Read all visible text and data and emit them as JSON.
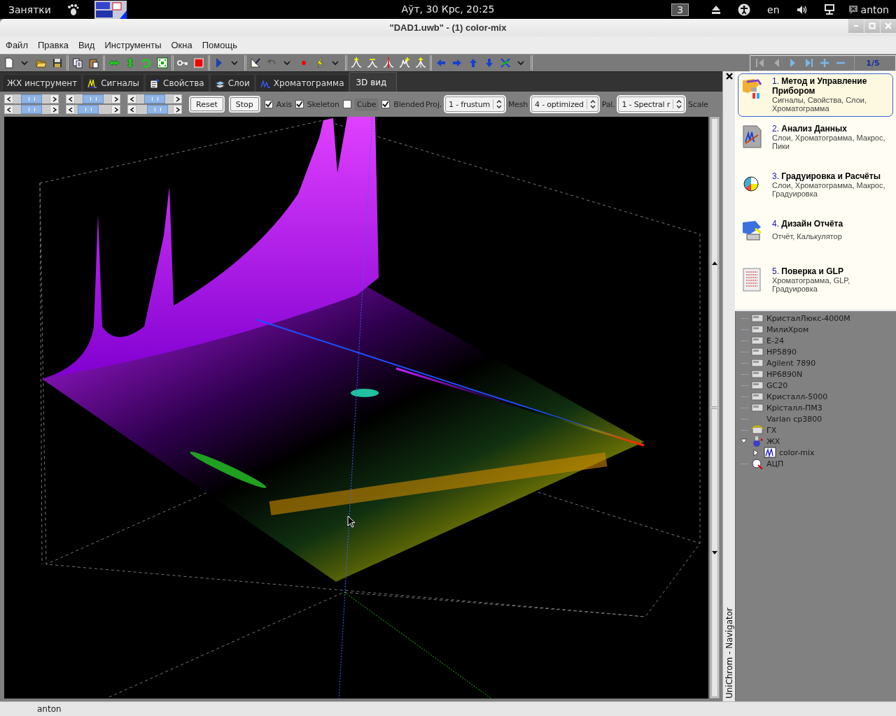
{
  "top_panel": {
    "activities": "Занятки",
    "clock": "Аўт, 30 Крс, 20:25",
    "workspace": "3",
    "keyboard_layout": "en",
    "user": "anton"
  },
  "window": {
    "title": "\"DAD1.uwb\" - (1) color-mix"
  },
  "menu": [
    "Файл",
    "Правка",
    "Вид",
    "Инструменты",
    "Окна",
    "Помощь"
  ],
  "toolbar": {
    "page_indicator": "1/5"
  },
  "tabs": [
    {
      "label": "ЖХ инструмент",
      "kind": "plain",
      "selected": false
    },
    {
      "label": "Сигналы",
      "kind": "signals",
      "selected": false
    },
    {
      "label": "Свойства",
      "kind": "properties",
      "selected": false
    },
    {
      "label": "Слои",
      "kind": "layers",
      "selected": false
    },
    {
      "label": "Хроматограмма",
      "kind": "chromatogram",
      "selected": false
    },
    {
      "label": "3D вид",
      "kind": "plain",
      "selected": true
    }
  ],
  "view_controls": {
    "buttons": [
      "Reset",
      "Stop"
    ],
    "checkboxes": [
      {
        "label": "Axis",
        "checked": true
      },
      {
        "label": "Skeleton",
        "checked": true
      },
      {
        "label": "Cube",
        "checked": false
      },
      {
        "label": "Blended",
        "checked": true
      }
    ],
    "selects": [
      {
        "label": "Proj.",
        "value": "1 - frustum"
      },
      {
        "label": "Mesh",
        "value": "4 - optimized"
      },
      {
        "label": "Pal.",
        "value": "1 - Spectral r"
      }
    ],
    "scale_label": "Scale"
  },
  "navigator": {
    "title": "UniChrom - Navigator",
    "items": [
      {
        "number": "1.",
        "title": "Метод и Управление Прибором",
        "subtitle": "Сигналы, Свойства, Слои, Хроматограмма",
        "kind": "method",
        "selected": true
      },
      {
        "number": "2.",
        "title": "Анализ Данных",
        "subtitle": "Слои, Хроматограмма, Макрос, Пики",
        "kind": "analysis",
        "selected": false
      },
      {
        "number": "3.",
        "title": "Градуировка и Расчёты",
        "subtitle": "Слои, Хроматограмма, Макрос, Градуировка",
        "kind": "calibration",
        "selected": false
      },
      {
        "number": "4.",
        "title": "Дизайн Отчёта",
        "subtitle": "Отчёт, Калькулятор",
        "kind": "report",
        "selected": false
      },
      {
        "number": "5.",
        "title": "Поверка и GLP",
        "subtitle": "Хроматограмма, GLP, Градуировка",
        "kind": "verification",
        "selected": false
      }
    ]
  },
  "tree": [
    {
      "label": "КристалЛюкс-4000М",
      "kind": "device"
    },
    {
      "label": "МилиХром",
      "kind": "device"
    },
    {
      "label": "E-24",
      "kind": "device"
    },
    {
      "label": "HP5890",
      "kind": "device"
    },
    {
      "label": "Agilent 7890",
      "kind": "device"
    },
    {
      "label": "HP6890N",
      "kind": "device"
    },
    {
      "label": "GC20",
      "kind": "device"
    },
    {
      "label": "Кристалл-5000",
      "kind": "device"
    },
    {
      "label": "Крісталл-ПМ3",
      "kind": "device"
    },
    {
      "label": "Varian cp3800",
      "kind": "none"
    },
    {
      "label": "ГХ",
      "kind": "gc"
    },
    {
      "label": "ЖХ",
      "kind": "lc",
      "expanded": true,
      "children": [
        {
          "label": "color-mix",
          "kind": "chart",
          "expanded": false
        }
      ]
    },
    {
      "label": "АЦП",
      "kind": "adc"
    }
  ],
  "status_bar": {
    "user": "anton"
  }
}
